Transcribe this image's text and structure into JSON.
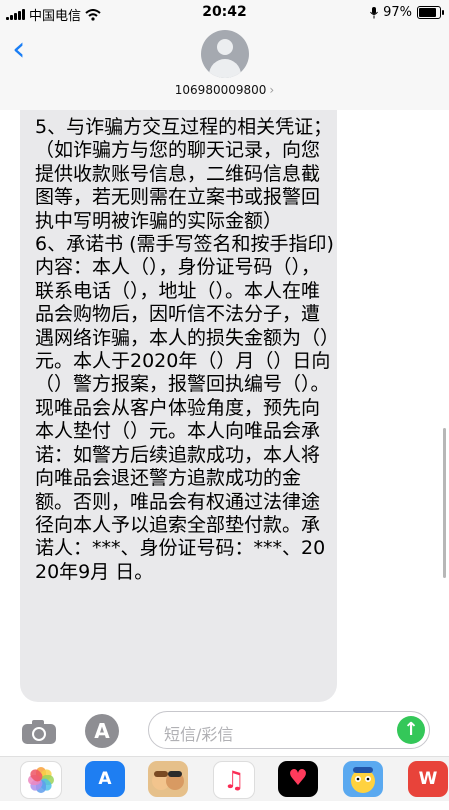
{
  "status_bar": {
    "carrier": "中国电信",
    "time": "20:42",
    "battery_percent": "97%",
    "battery_level": 0.97
  },
  "header": {
    "sender": "106980009800",
    "sender_chevron": "›",
    "back_icon": "chevron-left"
  },
  "message": {
    "text": "5、与诈骗方交互过程的相关凭证；（如诈骗方与您的聊天记录，向您提供收款账号信息，二维码信息截图等，若无则需在立案书或报警回执中写明被诈骗的实际金额）\n6、承诺书 (需手写签名和按手指印)\n内容：本人（），身份证号码（），联系电话（），地址（）。本人在唯品会购物后，因听信不法分子，遭遇网络诈骗，本人的损失金额为（）元。本人于2020年（）月（）日向（）警方报案，报警回执编号（）。现唯品会从客户体验角度，预先向本人垫付（）元。本人向唯品会承诺：如警方后续追款成功，本人将向唯品会退还警方追款成功的金额。否则，唯品会有权通过法律途径向本人予以追索全部垫付款。承诺人：***、身份证号码：***、2020年9月 日。"
  },
  "input_bar": {
    "placeholder": "短信/彩信",
    "camera_icon": "camera",
    "apps_icon": "app-store",
    "send_icon": "arrow-up"
  },
  "app_strip": {
    "apps": [
      "photos",
      "app-store",
      "memoji",
      "music",
      "heart-stickers",
      "cartoon-stickers",
      "wps-office"
    ],
    "wps_label": "W",
    "music_glyph": "♫",
    "heart_glyph": "♥",
    "store_glyph": "A"
  }
}
